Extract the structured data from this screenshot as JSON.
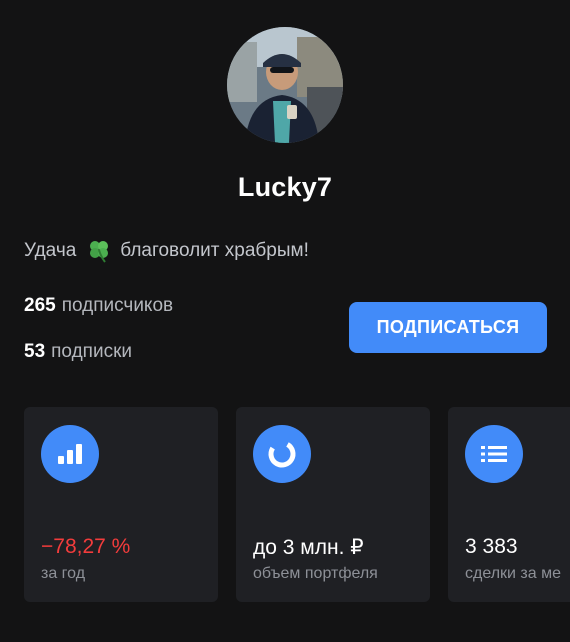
{
  "profile": {
    "username": "Lucky7",
    "bio_before": "Удача",
    "bio_after": "благоволит храбрым!",
    "bio_emoji_icon": "four-leaf-clover-icon"
  },
  "stats": {
    "followers_count": "265",
    "followers_label": "подписчиков",
    "following_count": "53",
    "following_label": "подписки"
  },
  "actions": {
    "subscribe_label": "ПОДПИСАТЬСЯ"
  },
  "cards": [
    {
      "icon": "bar-chart-icon",
      "value": "−78,27 %",
      "caption": "за год"
    },
    {
      "icon": "donut-chart-icon",
      "value": "до 3 млн. ₽",
      "caption": "объем портфеля"
    },
    {
      "icon": "list-icon",
      "value": "3 383",
      "caption": "сделки за ме"
    }
  ],
  "colors": {
    "accent": "#428bf9",
    "negative": "#f33c3c",
    "background": "#131314",
    "card": "#1f2024"
  }
}
